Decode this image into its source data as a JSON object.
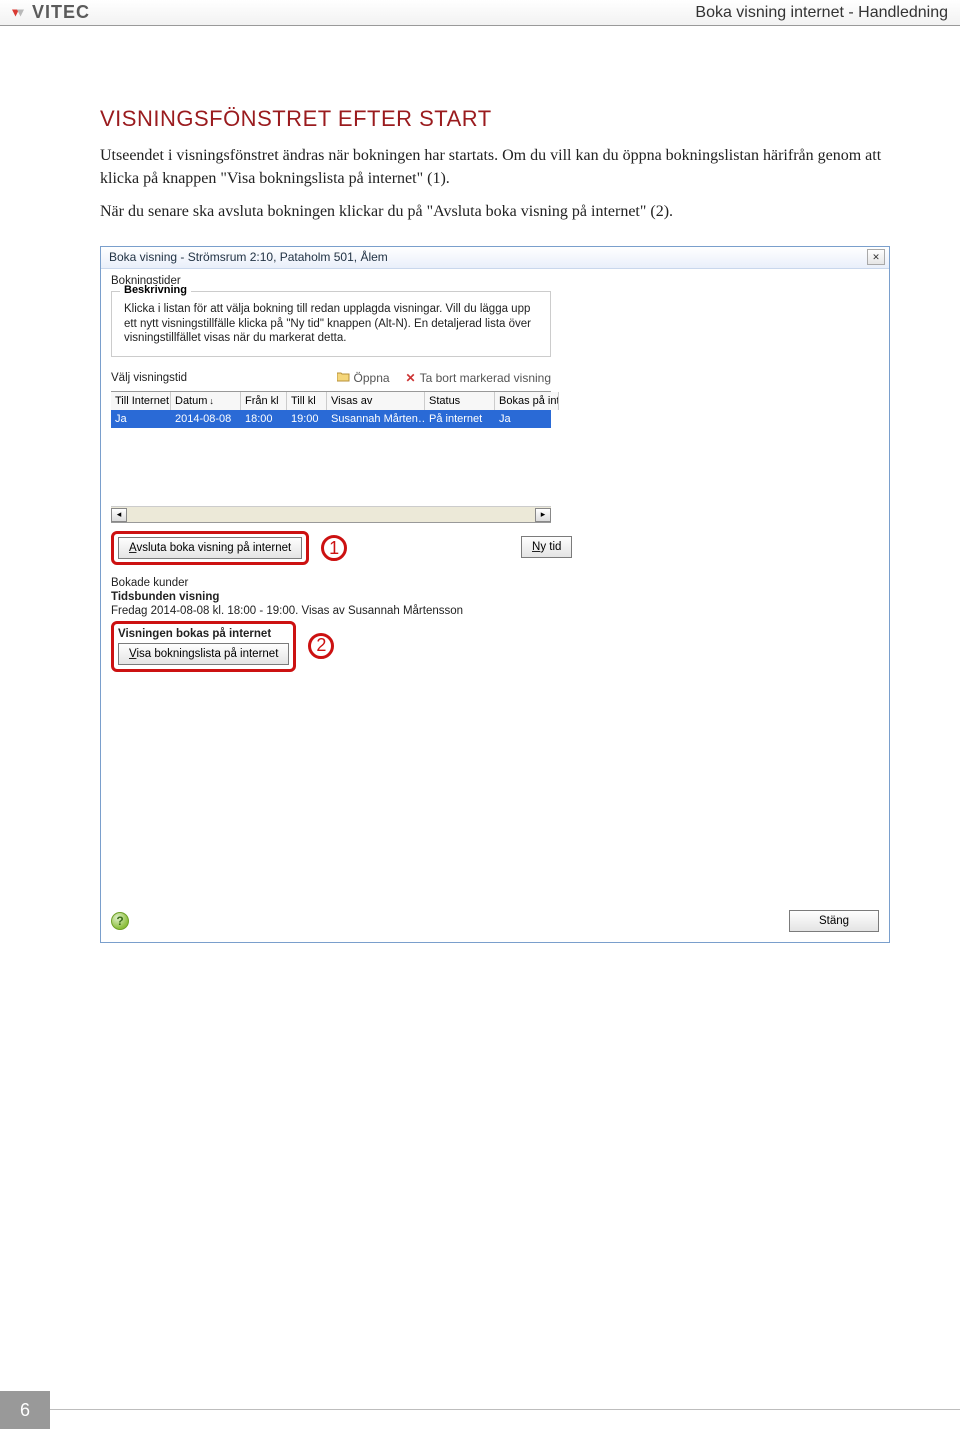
{
  "header": {
    "brand": "VITEC",
    "docTitle": "Boka visning internet - Handledning"
  },
  "section": {
    "heading": "VISNINGSFÖNSTRET EFTER START",
    "p1": "Utseendet i visningsfönstret ändras när bokningen har startats. Om du vill kan du öppna bokningslistan härifrån genom att klicka på knappen \"Visa bokningslista på internet\" (1).",
    "p2": "När du senare ska avsluta bokningen klickar du på \"Avsluta boka visning på internet\" (2)."
  },
  "dialog": {
    "title": "Boka visning - Strömsrum 2:10, Pataholm 501, Ålem",
    "close": "✕",
    "bokningstiderLabel": "Bokningstider",
    "beskrivningTitle": "Beskrivning",
    "beskrivningText": "Klicka i listan för att välja bokning till redan upplagda visningar. Vill du lägga upp ett nytt visningstillfälle klicka på \"Ny tid\" knappen (Alt-N). En detaljerad lista över visningstillfället visas när du markerat detta.",
    "valjVisningstid": "Välj visningstid",
    "oppna": "Öppna",
    "taBort": "Ta bort markerad visning",
    "columns": {
      "c1": "Till Internet",
      "c2": "Datum",
      "c3": "Från kl",
      "c4": "Till kl",
      "c5": "Visas av",
      "c6": "Status",
      "c7": "Bokas på intern"
    },
    "row": {
      "c1": "Ja",
      "c2": "2014-08-08",
      "c3": "18:00",
      "c4": "19:00",
      "c5": "Susannah Mårten…",
      "c6": "På internet",
      "c7": "Ja"
    },
    "avslutaBtn": "Avsluta boka visning på internet",
    "nyTidBtn": "Ny tid",
    "bokadeKunder": "Bokade kunder",
    "tidsbundenTitle": "Tidsbunden visning",
    "tidsbundenLine": "Fredag 2014-08-08 kl. 18:00 - 19:00. Visas av Susannah Mårtensson",
    "visningenBokas": "Visningen bokas på internet",
    "visaBokningslistaBtn": "Visa bokningslista på internet",
    "stangBtn": "Stäng"
  },
  "callouts": {
    "one": "1",
    "two": "2"
  },
  "pageNumber": "6"
}
